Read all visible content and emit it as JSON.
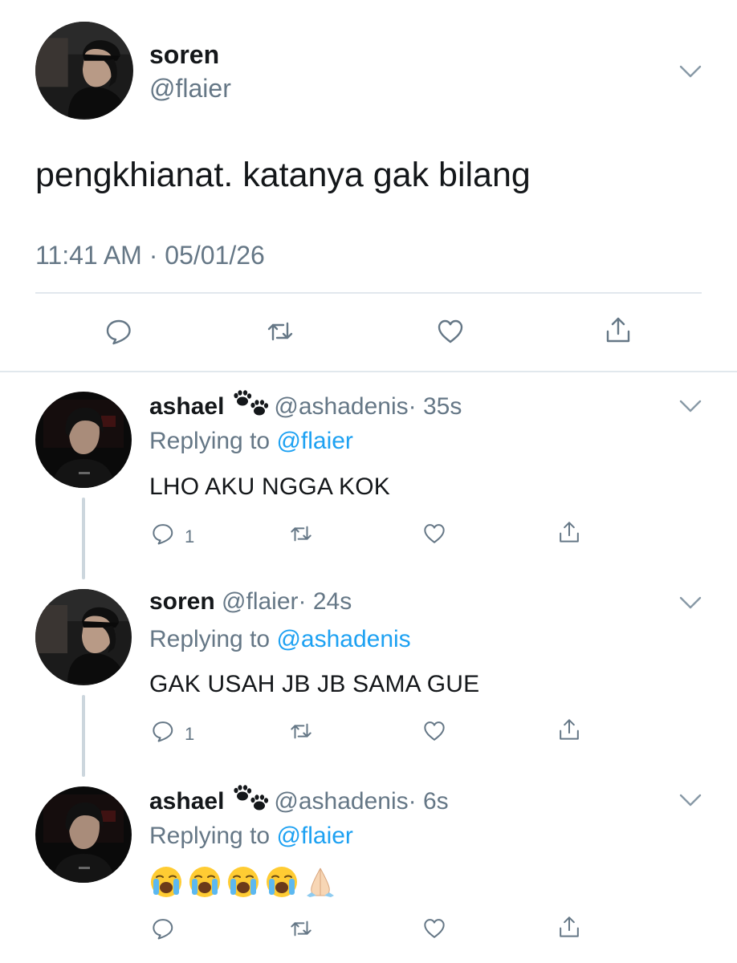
{
  "main_tweet": {
    "name": "soren",
    "handle": "@flaier",
    "text": "pengkhianat. katanya gak bilang",
    "timestamp": "11:41 AM · 05/01/26"
  },
  "replies": [
    {
      "name": "ashael",
      "handle": "@ashadenis",
      "time": "· 35s",
      "replying_label": "Replying to",
      "replying_to": "@flaier",
      "text": "LHO AKU NGGA KOK",
      "reply_count": "1"
    },
    {
      "name": "soren",
      "handle": "@flaier",
      "time": "· 24s",
      "replying_label": "Replying to",
      "replying_to": "@ashadenis",
      "text": "GAK USAH JB JB SAMA GUE",
      "reply_count": "1"
    },
    {
      "name": "ashael",
      "handle": "@ashadenis",
      "time": "· 6s",
      "replying_label": "Replying to",
      "replying_to": "@flaier",
      "text_emojis": [
        "loudly-crying-face",
        "loudly-crying-face",
        "loudly-crying-face",
        "loudly-crying-face",
        "folded-hands"
      ]
    }
  ],
  "icons": [
    "chevron-down-icon",
    "reply-icon",
    "retweet-icon",
    "like-icon",
    "share-icon",
    "paw-prints-icon"
  ],
  "colors": {
    "text": "#14171a",
    "muted": "#657786",
    "link": "#1da1f2",
    "divider": "#e1e8ed",
    "thread": "#ccd6dd"
  }
}
